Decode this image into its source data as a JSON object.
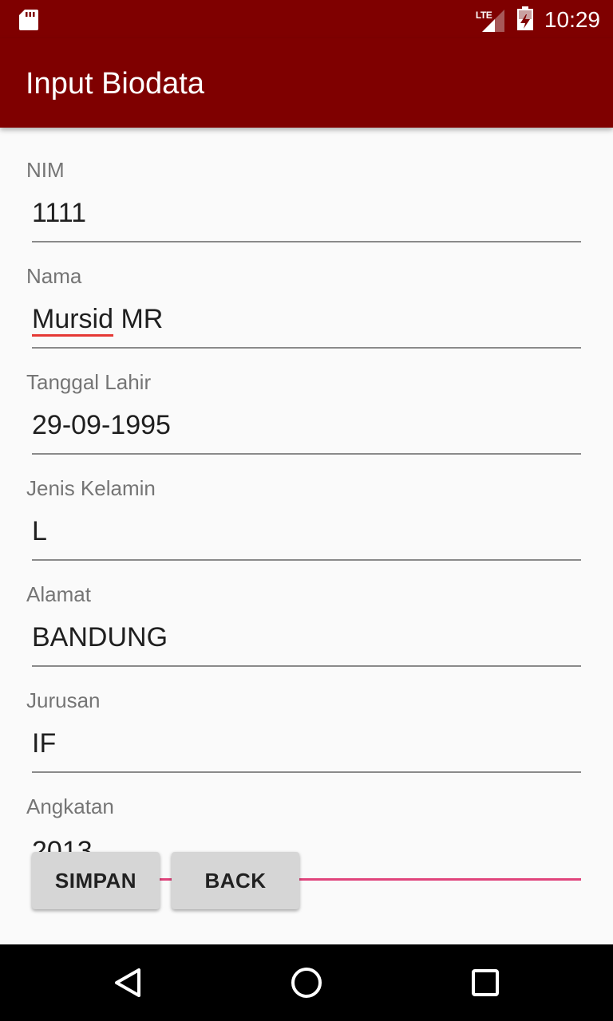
{
  "status_bar": {
    "network_label": "LTE",
    "time": "10:29",
    "icons": [
      "sd-card-icon",
      "lte-signal-icon",
      "battery-icon"
    ]
  },
  "app_bar": {
    "title": "Input Biodata"
  },
  "form": {
    "fields": [
      {
        "label": "NIM",
        "value": "1111"
      },
      {
        "label": "Nama",
        "value": "Mursid MR",
        "misspelled_word": "Mursid",
        "rest": " MR"
      },
      {
        "label": "Tanggal Lahir",
        "value": "29-09-1995"
      },
      {
        "label": "Jenis Kelamin",
        "value": "L"
      },
      {
        "label": "Alamat",
        "value": "BANDUNG"
      },
      {
        "label": "Jurusan",
        "value": "IF"
      },
      {
        "label": "Angkatan",
        "value": "2013"
      }
    ]
  },
  "buttons": {
    "save_label": "SIMPAN",
    "back_label": "BACK"
  },
  "nav_bar": {
    "icons": [
      "back-triangle-icon",
      "home-circle-icon",
      "recents-square-icon"
    ]
  },
  "colors": {
    "primary_dark": "#7f0000",
    "accent": "#e0447c",
    "spell_error": "#e53935"
  }
}
